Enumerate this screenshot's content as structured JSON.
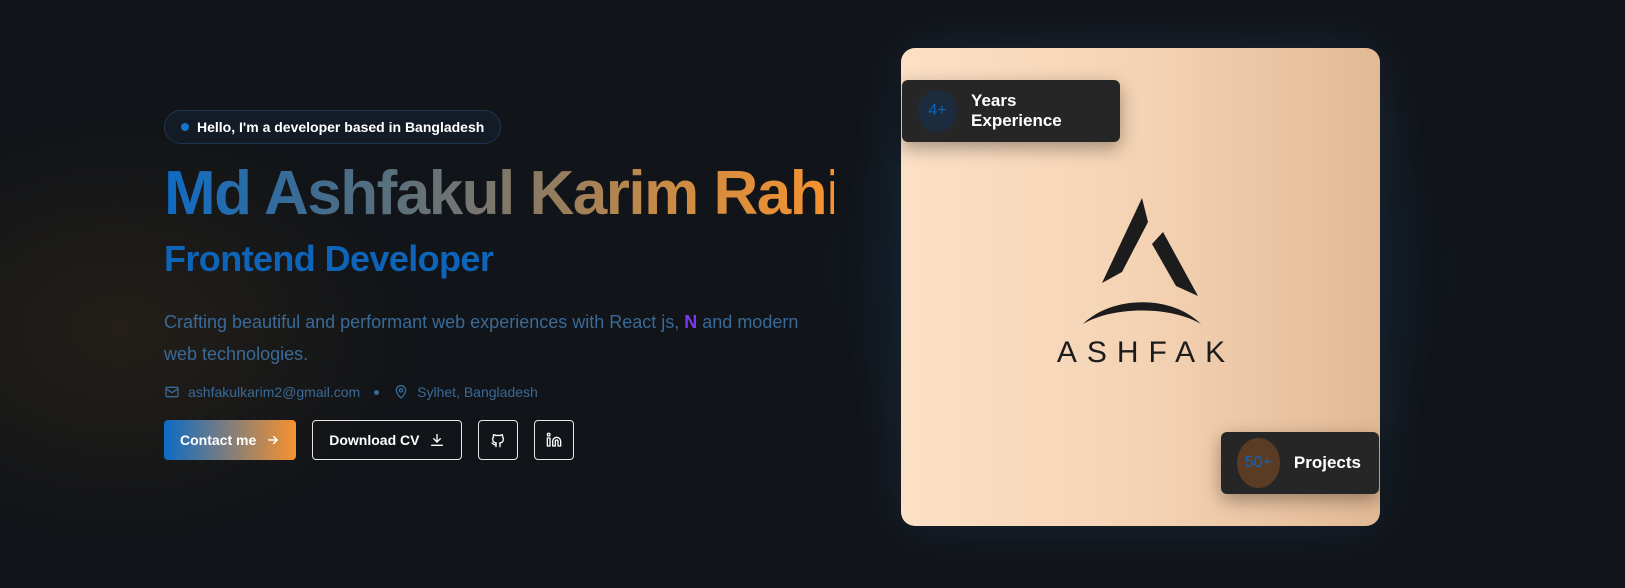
{
  "hero": {
    "badge": "Hello, I'm a developer based in Bangladesh",
    "name": "Md Ashfakul Karim Rahi",
    "role": "Frontend Developer",
    "tagline_before": "Crafting beautiful and performant web experiences with React js, ",
    "tagline_highlight": "N",
    "tagline_after": " and modern web technologies.",
    "email": "ashfakulkarim2@gmail.com",
    "location": "Sylhet, Bangladesh",
    "contact_label": "Contact me",
    "download_label": "Download CV",
    "icons": {
      "email": "mail-icon",
      "location": "map-pin-icon",
      "contact": "arrow-right-icon",
      "download": "download-icon",
      "github": "github-icon",
      "linkedin": "linkedin-icon"
    }
  },
  "card": {
    "logo_text": "ASHFAK",
    "stats": [
      {
        "number": "4+",
        "label": "Years Experience"
      },
      {
        "number": "50+",
        "label": "Projects"
      }
    ]
  },
  "colors": {
    "background": "#111418",
    "accent_blue": "#0d64b8",
    "accent_orange": "#f7922f",
    "highlight_purple": "#7c3aed",
    "card_peach": "#f4d3b4"
  }
}
